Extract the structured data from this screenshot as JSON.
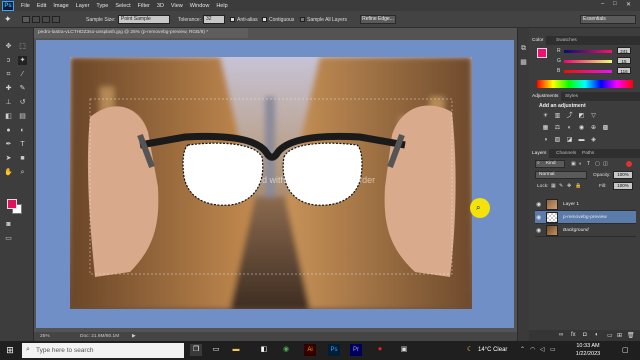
{
  "app": {
    "logo": "Ps",
    "menu": [
      "File",
      "Edit",
      "Image",
      "Layer",
      "Type",
      "Select",
      "Filter",
      "3D",
      "View",
      "Window",
      "Help"
    ]
  },
  "options": {
    "sample_size_label": "Sample Size:",
    "sample_size_value": "Point Sample",
    "tolerance_label": "Tolerance:",
    "tolerance_value": "32",
    "anti_alias": "Anti-alias",
    "contiguous": "Contiguous",
    "sample_all_layers": "Sample All Layers",
    "refine_edge": "Refine Edge...",
    "workspace": "Essentials"
  },
  "document": {
    "tab_title": "pedro-lastra-vLCTHDZ3so-unsplash.jpg @ 25% (p-removebg-preview, RGB/8) *",
    "watermark": "Recorded with iTop Screen Recorder",
    "zoom": "25%",
    "doc_info": "Doc: 21.6M/80.1M"
  },
  "color_panel": {
    "tabs": [
      "Color",
      "Swatches"
    ],
    "channels": [
      {
        "label": "R",
        "value": "241"
      },
      {
        "label": "G",
        "value": "15"
      },
      {
        "label": "B",
        "value": "116"
      }
    ],
    "fg_color": "#f10f74"
  },
  "adjustments_panel": {
    "tabs": [
      "Adjustments",
      "Styles"
    ],
    "heading": "Add an adjustment"
  },
  "layers_panel": {
    "tabs": [
      "Layers",
      "Channels",
      "Paths"
    ],
    "kind_label": "Kind",
    "blend_mode": "Normal",
    "opacity_label": "Opacity:",
    "opacity_value": "100%",
    "lock_label": "Lock:",
    "fill_label": "Fill:",
    "fill_value": "100%",
    "layers": [
      {
        "name": "Layer 1",
        "selected": false
      },
      {
        "name": "p-removebg-preview",
        "selected": true
      },
      {
        "name": "Background",
        "selected": false
      }
    ]
  },
  "taskbar": {
    "search_placeholder": "Type here to search",
    "weather": "14°C  Clear",
    "time": "10:33 AM",
    "date": "1/22/2023"
  }
}
